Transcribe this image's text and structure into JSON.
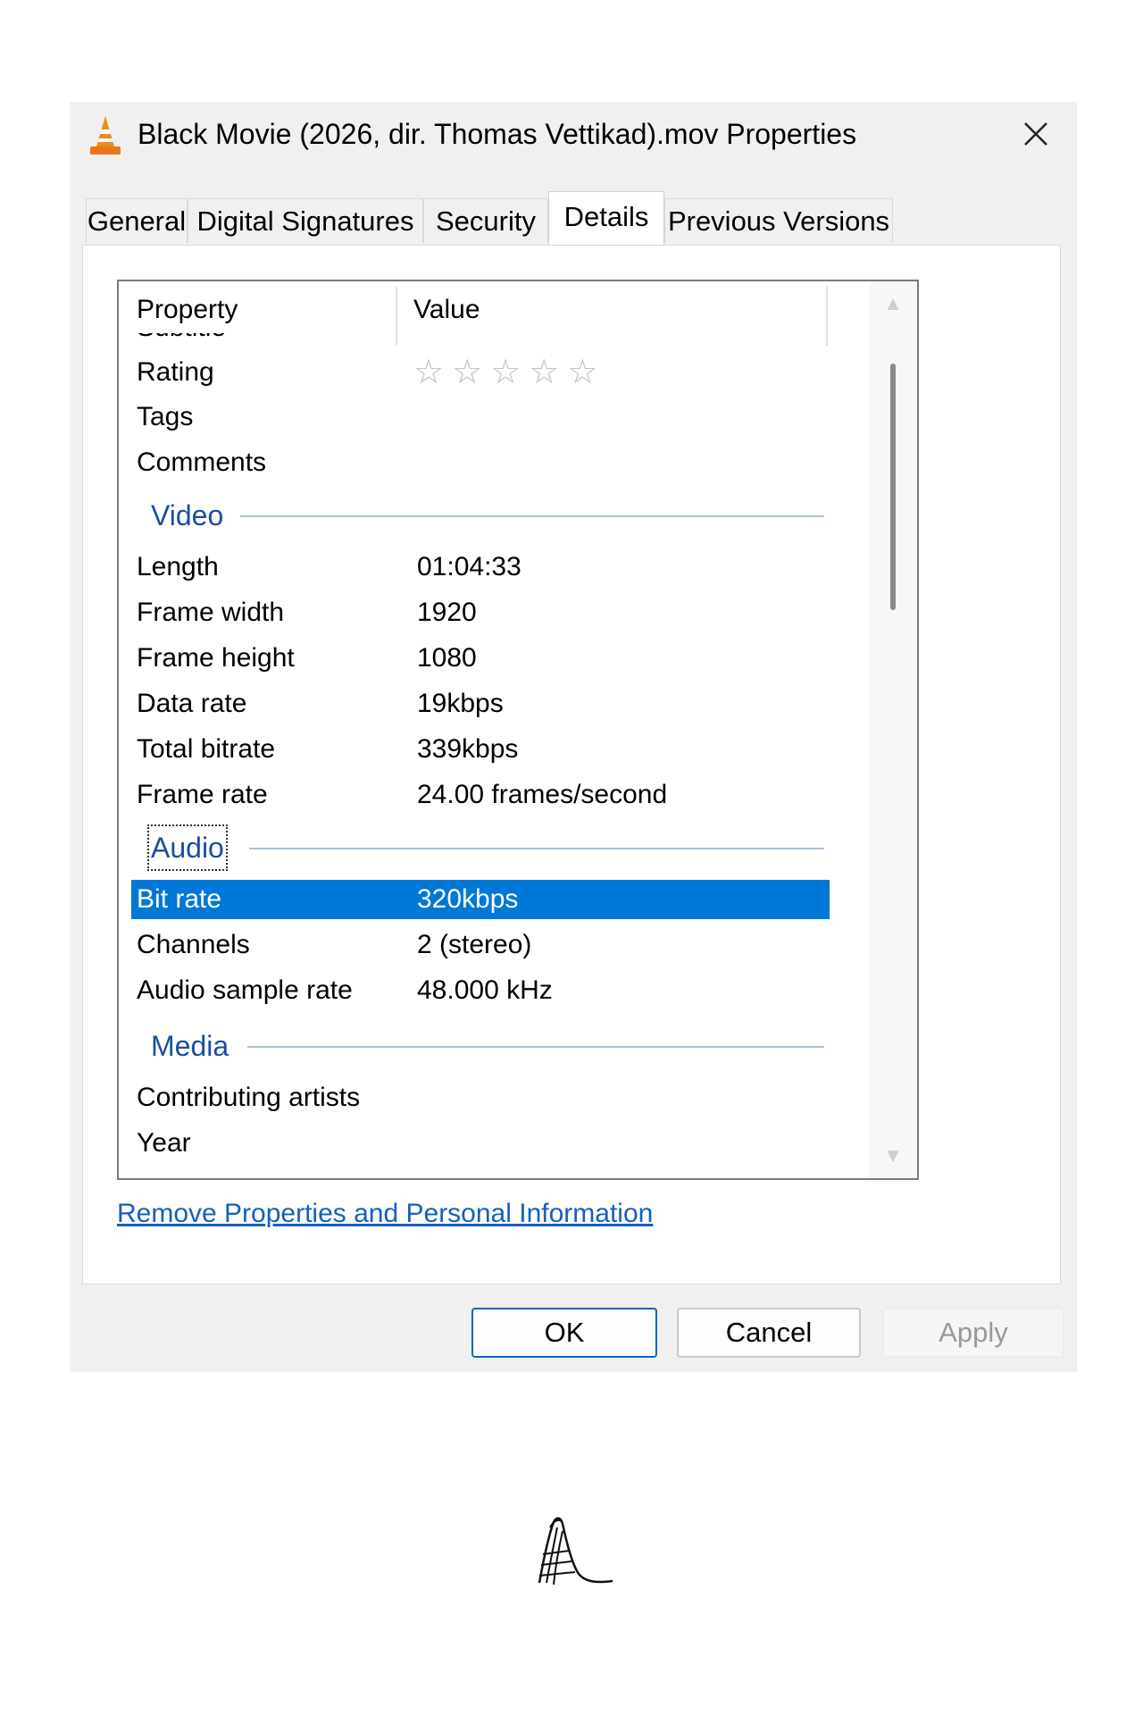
{
  "window": {
    "title": "Black Movie (2026, dir. Thomas Vettikad).mov Properties",
    "app_icon": "vlc-cone-icon",
    "close_icon": "close-icon"
  },
  "tabs": [
    {
      "label": "General",
      "active": false
    },
    {
      "label": "Digital Signatures",
      "active": false
    },
    {
      "label": "Security",
      "active": false
    },
    {
      "label": "Details",
      "active": true
    },
    {
      "label": "Previous Versions",
      "active": false
    }
  ],
  "details": {
    "headers": {
      "property": "Property",
      "value": "Value"
    },
    "cut_off_row": "Subtitle",
    "rating": {
      "label": "Rating",
      "stars": 0,
      "max": 5
    },
    "rows_top": [
      {
        "property": "Tags",
        "value": ""
      },
      {
        "property": "Comments",
        "value": ""
      }
    ],
    "video": {
      "title": "Video",
      "rows": [
        {
          "property": "Length",
          "value": "01:04:33"
        },
        {
          "property": "Frame width",
          "value": "1920"
        },
        {
          "property": "Frame height",
          "value": "1080"
        },
        {
          "property": "Data rate",
          "value": "19kbps"
        },
        {
          "property": "Total bitrate",
          "value": "339kbps"
        },
        {
          "property": "Frame rate",
          "value": "24.00 frames/second"
        }
      ]
    },
    "audio": {
      "title": "Audio",
      "rows": [
        {
          "property": "Bit rate",
          "value": "320kbps",
          "selected": true
        },
        {
          "property": "Channels",
          "value": "2 (stereo)"
        },
        {
          "property": "Audio sample rate",
          "value": "48.000 kHz"
        }
      ]
    },
    "media": {
      "title": "Media",
      "rows": [
        {
          "property": "Contributing artists",
          "value": ""
        },
        {
          "property": "Year",
          "value": ""
        }
      ]
    }
  },
  "remove_link": "Remove Properties and Personal Information",
  "buttons": {
    "ok": "OK",
    "cancel": "Cancel",
    "apply": "Apply"
  },
  "colors": {
    "selection": "#0078d7",
    "section_header": "#1c4da1",
    "link": "#1560bd",
    "dialog_bg": "#f0f0f0"
  },
  "signature": "handwritten-signature"
}
